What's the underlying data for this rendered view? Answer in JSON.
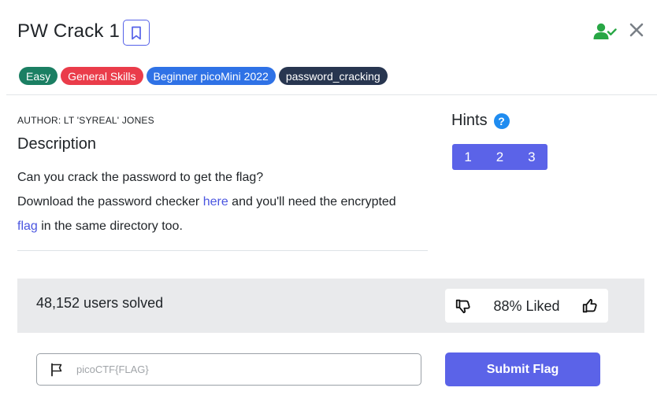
{
  "challenge": {
    "title": "PW Crack 1",
    "tags": [
      {
        "label": "Easy",
        "color": "#1b7f63"
      },
      {
        "label": "General Skills",
        "color": "#ea3c4a"
      },
      {
        "label": "Beginner picoMini 2022",
        "color": "#2f72e6"
      },
      {
        "label": "password_cracking",
        "color": "#283650"
      }
    ],
    "author": "AUTHOR: LT 'SYREAL' JONES",
    "description_heading": "Description",
    "description": {
      "line1": "Can you crack the password to get the flag?",
      "line2_pre": "Download the password checker ",
      "line2_link": "here",
      "line2_post": " and you'll need the encrypted",
      "line3_link": "flag",
      "line3_post": " in the same directory too."
    }
  },
  "hints": {
    "heading": "Hints",
    "help_icon": "question-circle-icon",
    "buttons": [
      "1",
      "2",
      "3"
    ]
  },
  "stats": {
    "solved": "48,152 users solved",
    "liked": "88% Liked"
  },
  "flag_form": {
    "placeholder": "picoCTF{FLAG}",
    "value": "",
    "submit_label": "Submit Flag"
  },
  "colors": {
    "accent": "#5b63e8",
    "user_check": "#28a745",
    "stats_bg": "#e9eaec"
  }
}
